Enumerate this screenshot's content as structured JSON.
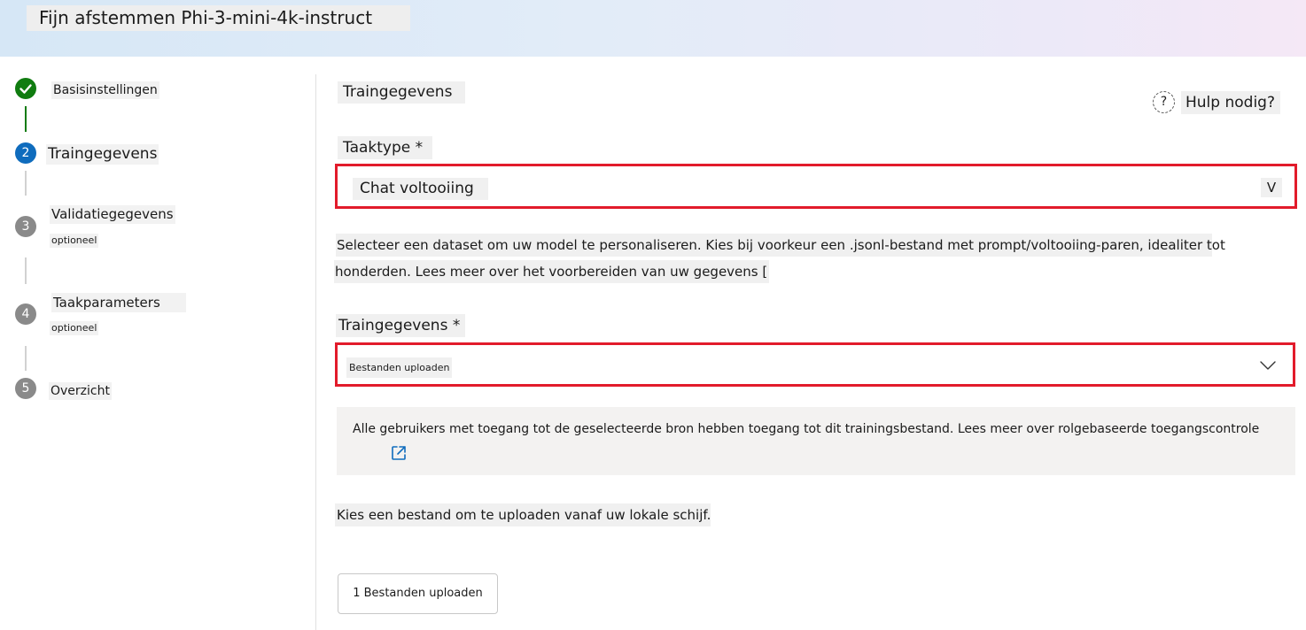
{
  "header": {
    "title": "Fijn afstemmen Phi-3-mini-4k-instruct"
  },
  "steps": [
    {
      "number": "",
      "label": "Basisinstellingen",
      "sub": "",
      "state": "done"
    },
    {
      "number": "2",
      "label": "Traingegevens",
      "sub": "",
      "state": "active"
    },
    {
      "number": "3",
      "label": "Validatiegegevens",
      "sub": "optioneel",
      "state": "todo"
    },
    {
      "number": "4",
      "label": "Taakparameters",
      "sub": "optioneel",
      "state": "todo"
    },
    {
      "number": "5",
      "label": "Overzicht",
      "sub": "",
      "state": "todo"
    }
  ],
  "main": {
    "section_title": "Traingegevens",
    "help_icon": "?",
    "help_label": "Hulp nodig?",
    "task_type_label": "Taaktype *",
    "task_type_value": "Chat voltooiing",
    "task_type_chevron": "V",
    "description_line1": "Selecteer een dataset om uw model te personaliseren. Kies bij voorkeur een .jsonl-bestand met prompt/voltooiing-paren, idealiter tot",
    "description_line2": "honderden. Lees meer over het voorbereiden van uw gegevens [",
    "training_data_label": "Traingegevens *",
    "training_data_value": "Bestanden uploaden",
    "info_text": "Alle gebruikers met toegang tot de geselecteerde bron hebben toegang tot dit trainingsbestand. Lees meer over rolgebaseerde toegangscontrole",
    "choose_file_text": "Kies een bestand om te uploaden vanaf uw lokale schijf.",
    "upload_button_label": "1 Bestanden uploaden"
  },
  "colors": {
    "accent": "#0f6cbd",
    "done": "#107c10",
    "highlight": "#e21b2b"
  }
}
